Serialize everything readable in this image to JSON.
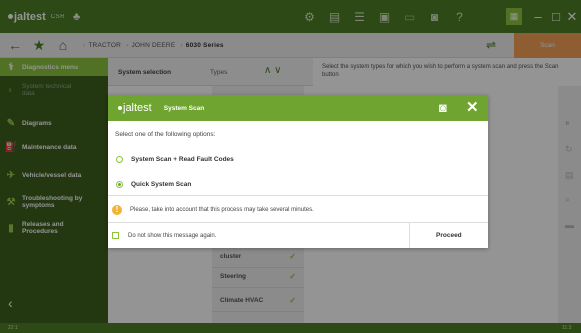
{
  "topbar": {
    "logo_text": "jaltest",
    "logo_sub": "CSR",
    "icons": [
      "tree-icon",
      "settings-icon",
      "document-icon",
      "list-icon",
      "printer-icon",
      "battery-icon",
      "camera-icon",
      "help-icon",
      "grid-icon",
      "minimize-icon",
      "maximize-icon",
      "close-icon"
    ]
  },
  "breadcrumb": {
    "items": [
      "TRACTOR",
      "JOHN DEERE",
      "6030 Series"
    ],
    "scan_label": "Scan"
  },
  "sidebar": {
    "items": [
      {
        "label": "Diagnostics menu",
        "icon": "diagnostics-icon",
        "active": true
      },
      {
        "label": "System technical data",
        "icon": "technical-data-icon",
        "dim": true
      },
      {
        "label": "Diagrams",
        "icon": "diagrams-icon"
      },
      {
        "label": "Maintenance data",
        "icon": "maintenance-icon"
      },
      {
        "label": "Vehicle/vessel data",
        "icon": "vehicle-icon"
      },
      {
        "label": "Troubleshooting by symptoms",
        "icon": "troubleshooting-icon"
      },
      {
        "label": "Releases and Procedures",
        "icon": "procedures-icon"
      }
    ]
  },
  "main": {
    "selection_title": "System selection",
    "types_label": "Types",
    "info_text": "Select the system types for which you wish to perform a system scan and press the Scan button",
    "list_items": [
      {
        "label": "cluster"
      },
      {
        "label": "Steering"
      },
      {
        "label": "Climate HVAC"
      }
    ]
  },
  "statusbar": {
    "left_text": "22:1",
    "right_text": "11:3"
  },
  "dialog": {
    "title": "System Scan",
    "logo_text": "jaltest",
    "prompt": "Select one of the following options:",
    "options": [
      {
        "label": "System Scan + Read Fault Codes",
        "selected": false
      },
      {
        "label": "Quick System Scan",
        "selected": true
      }
    ],
    "warning": "Please, take into account that this process may take several minutes.",
    "dont_show_label": "Do not show this message again.",
    "dont_show_checked": false,
    "proceed_label": "Proceed"
  },
  "colors": {
    "brand_green": "#4e7f25",
    "accent_green": "#8cc43e",
    "dialog_header": "#6fa431",
    "scan_orange": "#f5a055",
    "warning_yellow": "#f3b233"
  }
}
